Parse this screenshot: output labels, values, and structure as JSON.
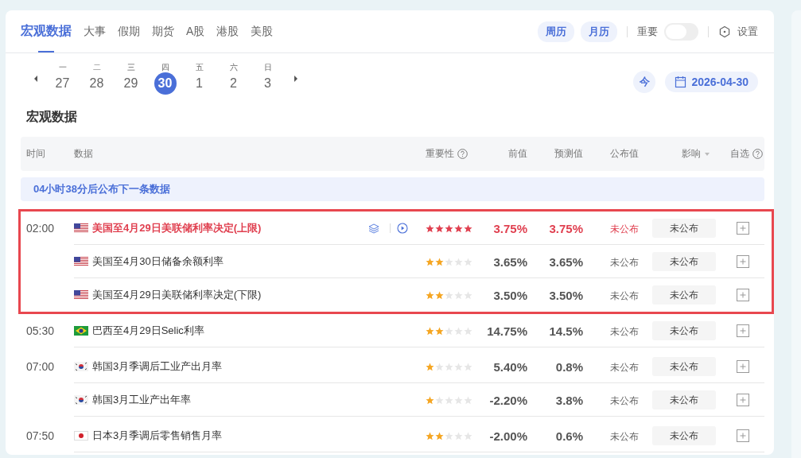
{
  "tabs": [
    {
      "label": "宏观数据",
      "selected": true
    },
    {
      "label": "大事",
      "selected": false
    },
    {
      "label": "假期",
      "selected": false
    },
    {
      "label": "期货",
      "selected": false
    },
    {
      "label": "A股",
      "selected": false
    },
    {
      "label": "港股",
      "selected": false
    },
    {
      "label": "美股",
      "selected": false
    }
  ],
  "view_buttons": [
    "周历",
    "月历"
  ],
  "important_toggle": {
    "label": "重要",
    "on": false
  },
  "settings": {
    "label": "设置"
  },
  "week": [
    {
      "weekday": "一",
      "day": "27",
      "selected": false
    },
    {
      "weekday": "二",
      "day": "28",
      "selected": false
    },
    {
      "weekday": "三",
      "day": "29",
      "selected": false
    },
    {
      "weekday": "四",
      "day": "30",
      "selected": true
    },
    {
      "weekday": "五",
      "day": "1",
      "selected": false
    },
    {
      "weekday": "六",
      "day": "2",
      "selected": false
    },
    {
      "weekday": "日",
      "day": "3",
      "selected": false
    }
  ],
  "today_button": "今",
  "date_button": "2026-04-30",
  "section_title": "宏观数据",
  "table": {
    "columns": [
      {
        "label": "时间",
        "kind": "text"
      },
      {
        "label": "数据",
        "kind": "text"
      },
      {
        "label": "重要性",
        "kind": "help"
      },
      {
        "label": "前值",
        "kind": "text"
      },
      {
        "label": "预测值",
        "kind": "text"
      },
      {
        "label": "公布值",
        "kind": "text"
      },
      {
        "label": "影响",
        "kind": "dropdown"
      },
      {
        "label": "自选",
        "kind": "help"
      }
    ],
    "banner": "04小时38分后公布下一条数据",
    "groups": [
      {
        "time": "02:00",
        "highlighted": true,
        "rows": [
          {
            "kind": "us",
            "title": "美国至4月29日美联储利率决定(上限)",
            "important": true,
            "extras": true,
            "stars": 5,
            "previous": "3.75%",
            "forecast": "3.75%",
            "actual": "未公布",
            "impact": "未公布"
          },
          {
            "kind": "us",
            "title": "美国至4月30日储备余额利率",
            "important": false,
            "extras": false,
            "stars": 2,
            "previous": "3.65%",
            "forecast": "3.65%",
            "actual": "未公布",
            "impact": "未公布"
          },
          {
            "kind": "us",
            "title": "美国至4月29日美联储利率决定(下限)",
            "important": false,
            "extras": false,
            "stars": 2,
            "previous": "3.50%",
            "forecast": "3.50%",
            "actual": "未公布",
            "impact": "未公布"
          }
        ]
      },
      {
        "time": "05:30",
        "highlighted": false,
        "rows": [
          {
            "kind": "br",
            "title": "巴西至4月29日Selic利率",
            "important": false,
            "extras": false,
            "stars": 2,
            "previous": "14.75%",
            "forecast": "14.5%",
            "actual": "未公布",
            "impact": "未公布"
          }
        ]
      },
      {
        "time": "07:00",
        "highlighted": false,
        "rows": [
          {
            "kind": "kr",
            "title": "韩国3月季调后工业产出月率",
            "important": false,
            "extras": false,
            "stars": 1,
            "previous": "5.40%",
            "forecast": "0.8%",
            "actual": "未公布",
            "impact": "未公布"
          },
          {
            "kind": "kr",
            "title": "韩国3月工业产出年率",
            "important": false,
            "extras": false,
            "stars": 1,
            "previous": "-2.20%",
            "forecast": "3.8%",
            "actual": "未公布",
            "impact": "未公布"
          }
        ]
      },
      {
        "time": "07:50",
        "highlighted": false,
        "rows": [
          {
            "kind": "jp",
            "title": "日本3月季调后零售销售月率",
            "important": false,
            "extras": false,
            "stars": 2,
            "previous": "-2.00%",
            "forecast": "0.6%",
            "actual": "未公布",
            "impact": "未公布"
          }
        ]
      }
    ]
  }
}
